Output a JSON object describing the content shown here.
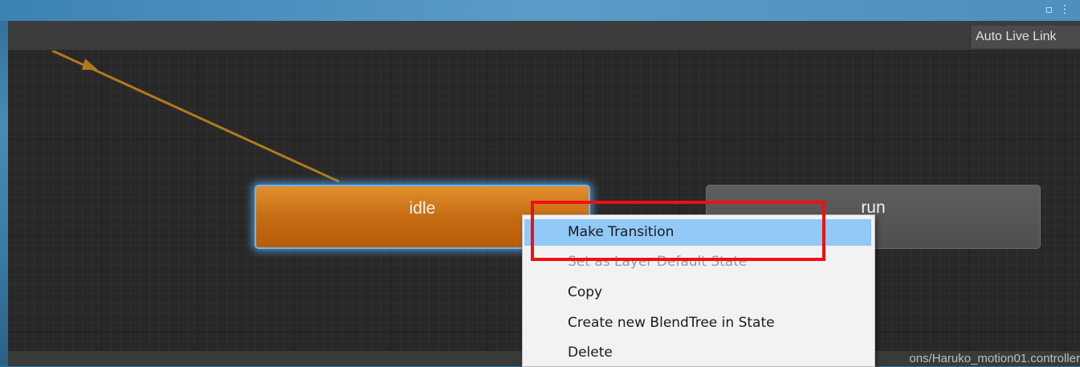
{
  "window": {
    "icons": [
      "restore-icon",
      "more-vert-icon"
    ],
    "icon_glyphs": "▫⋮"
  },
  "toolbar": {
    "auto_live_link": "Auto Live Link"
  },
  "graph": {
    "states": {
      "idle": {
        "label": "idle",
        "color": "#c46a12",
        "selected": true
      },
      "run": {
        "label": "run",
        "color": "#555555"
      }
    },
    "transition_color": "#b07a1c"
  },
  "context_menu": {
    "items": [
      {
        "label": "Make Transition",
        "highlighted": true,
        "enabled": true
      },
      {
        "label": "Set as Layer Default State",
        "highlighted": false,
        "enabled": false
      },
      {
        "label": "Copy",
        "highlighted": false,
        "enabled": true
      },
      {
        "label": "Create new BlendTree in State",
        "highlighted": false,
        "enabled": true
      },
      {
        "label": "Delete",
        "highlighted": false,
        "enabled": true
      }
    ]
  },
  "annotation": {
    "color": "#ee1111"
  },
  "statusbar": {
    "path": "ons/Haruko_motion01.controller"
  }
}
